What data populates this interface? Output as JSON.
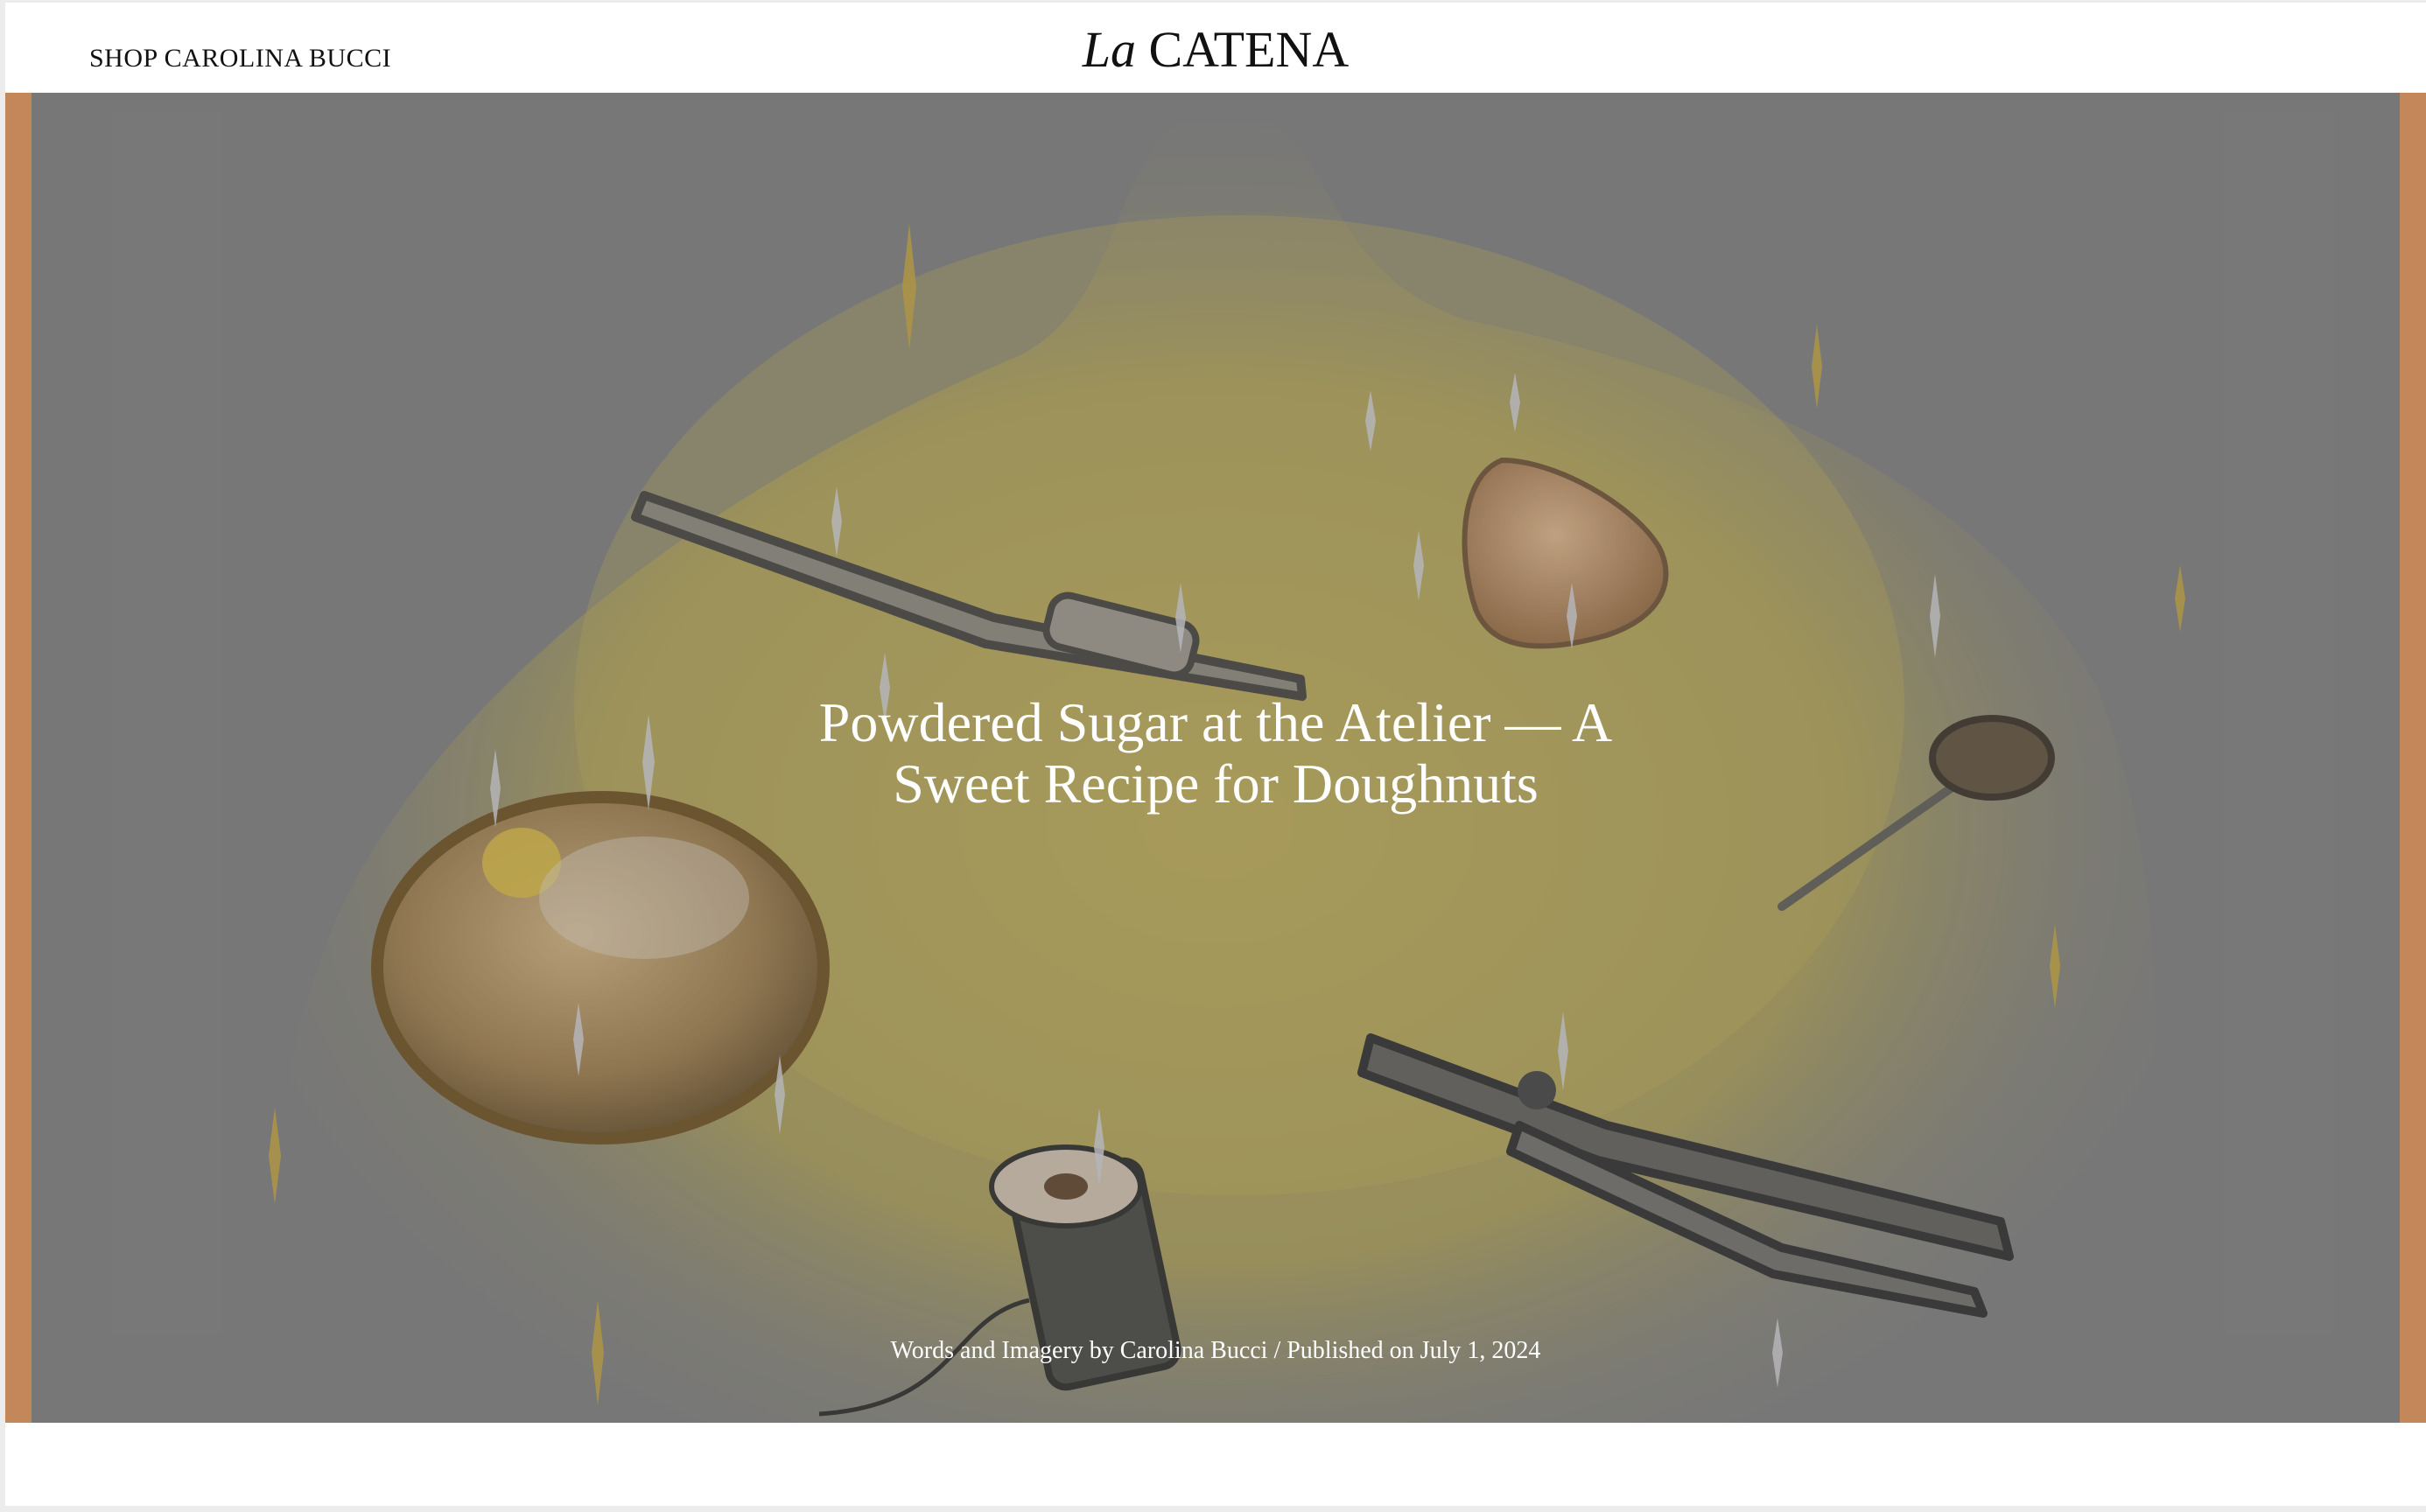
{
  "header": {
    "shop_link": "SHOP CAROLINA BUCCI",
    "logo_italic": "La",
    "logo_main": "CATENA"
  },
  "hero": {
    "title_line1": "Powdered Sugar at the Atelier — A",
    "title_line2": "Sweet Recipe for Doughnuts",
    "byline": "Words and Imagery by Carolina Bucci / Published on July 1, 2024"
  },
  "colors": {
    "border_accent": "#c4875a",
    "illustration_bg": "#7d7d7d",
    "powder_yellow": "#c9b548",
    "text_light": "#ffffff",
    "text_dark": "#111111"
  }
}
